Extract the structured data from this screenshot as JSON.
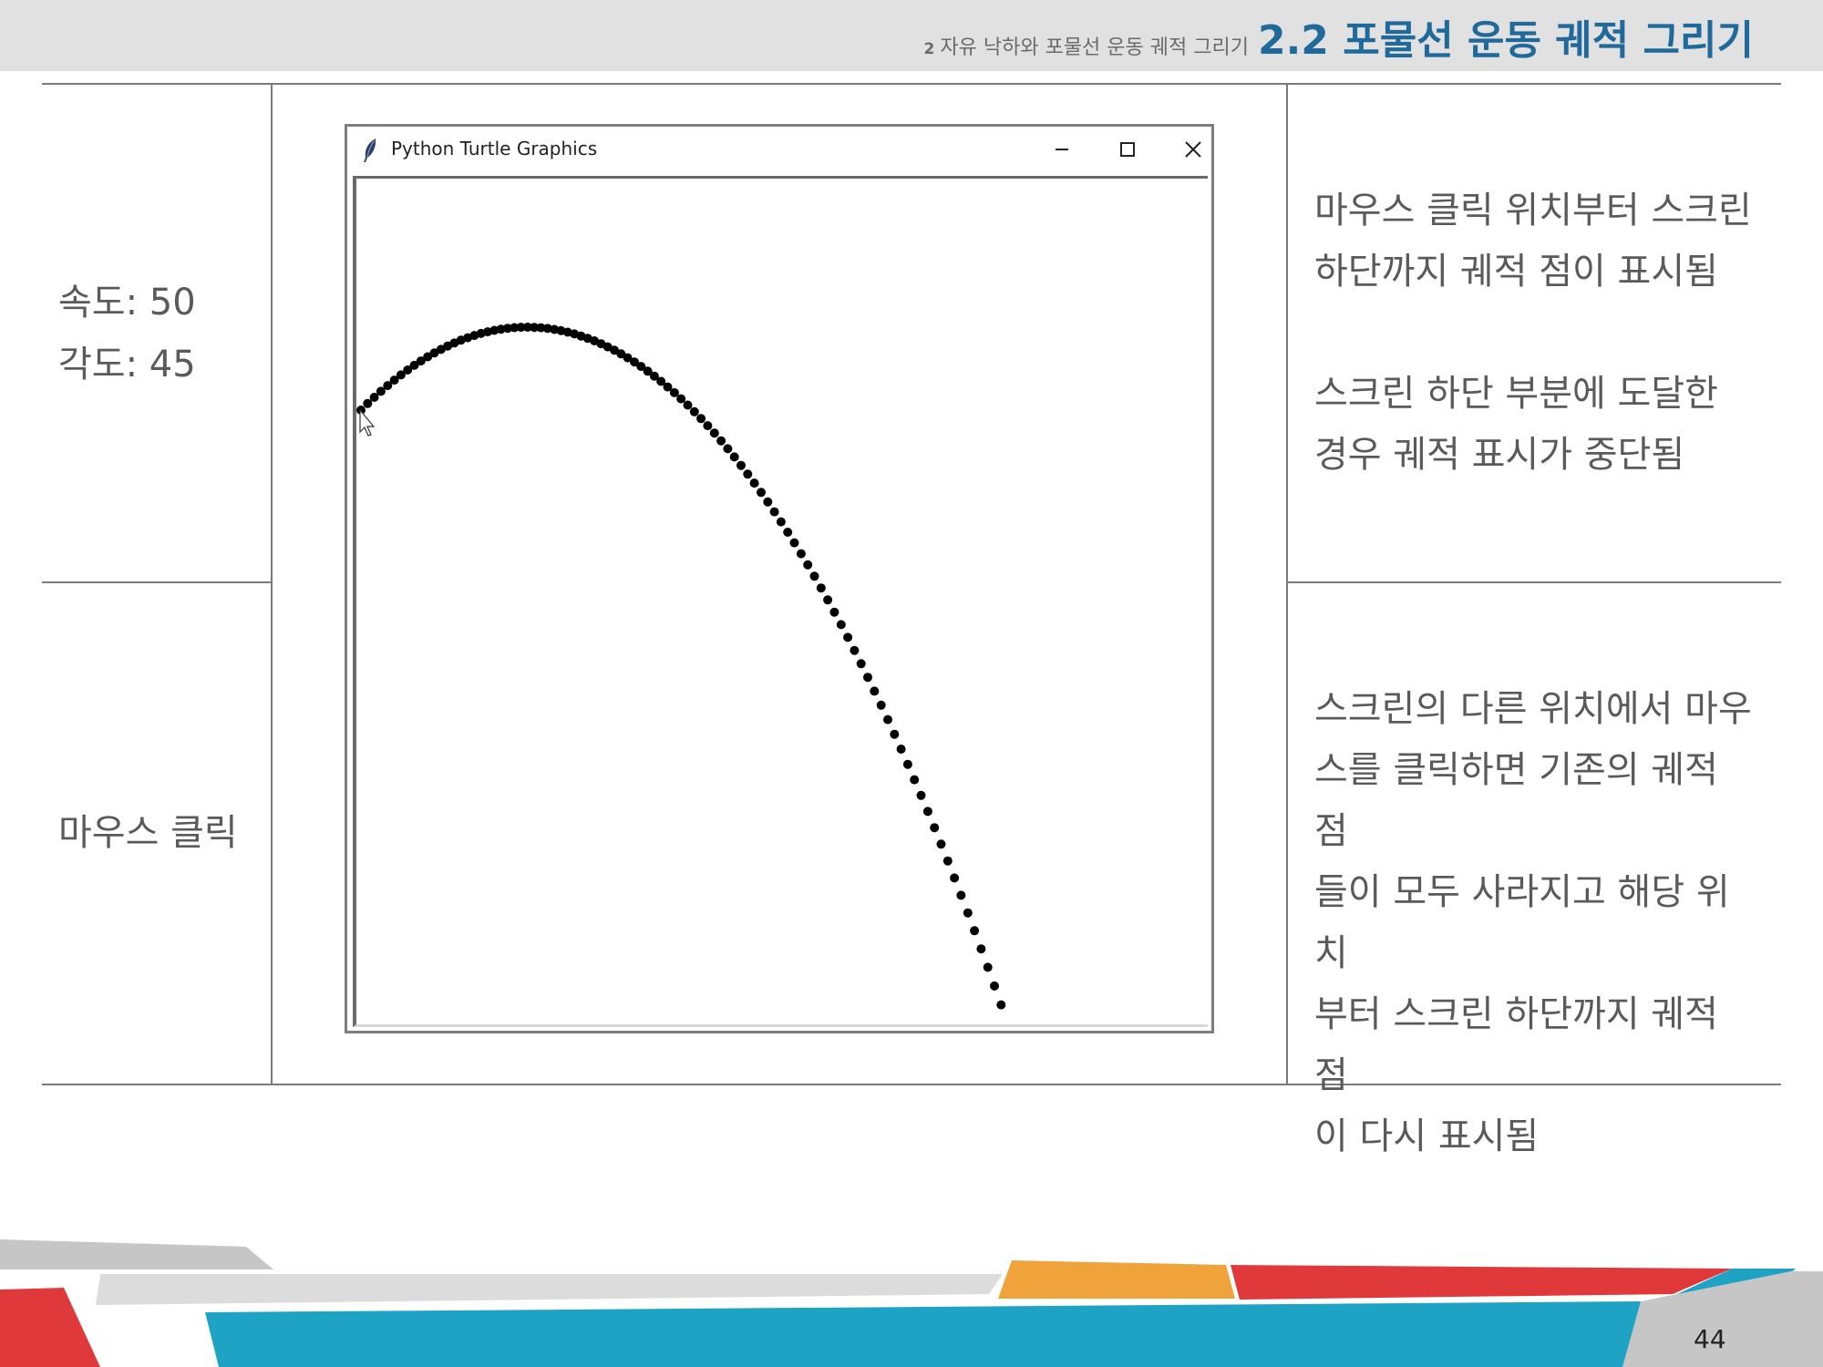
{
  "header": {
    "chapter_num": "2",
    "chapter_title": "자유 낙하와 포물선 운동 궤적 그리기",
    "section_title": "2.2 포물선 운동 궤적 그리기"
  },
  "rows": [
    {
      "label_lines": [
        "속도: 50",
        "각도: 45"
      ],
      "description": [
        "마우스 클릭 위치부터 스크린",
        "하단까지 궤적 점이 표시됨",
        "",
        "스크린 하단 부분에 도달한",
        "경우 궤적 표시가 중단됨"
      ]
    },
    {
      "label_lines": [
        "마우스 클릭"
      ],
      "description": [
        "스크린의 다른 위치에서 마우",
        "스를 클릭하면 기존의 궤적 점",
        "들이 모두 사라지고 해당 위치",
        "부터 스크린 하단까지 궤적 점",
        "이 다시 표시됨"
      ]
    }
  ],
  "window": {
    "title": "Python Turtle Graphics",
    "icons": [
      "feather-icon",
      "minimize-icon",
      "maximize-icon",
      "close-icon"
    ]
  },
  "trajectory": {
    "speed": 50,
    "angle_deg": 45,
    "dot_color": "#000000"
  },
  "footer": {
    "page_number": "44",
    "colors": {
      "red": "#e0393c",
      "teal": "#1fa3c4",
      "orange": "#f0a33a",
      "gray": "#d9d9d9",
      "darkgray": "#c6c6c6"
    }
  }
}
